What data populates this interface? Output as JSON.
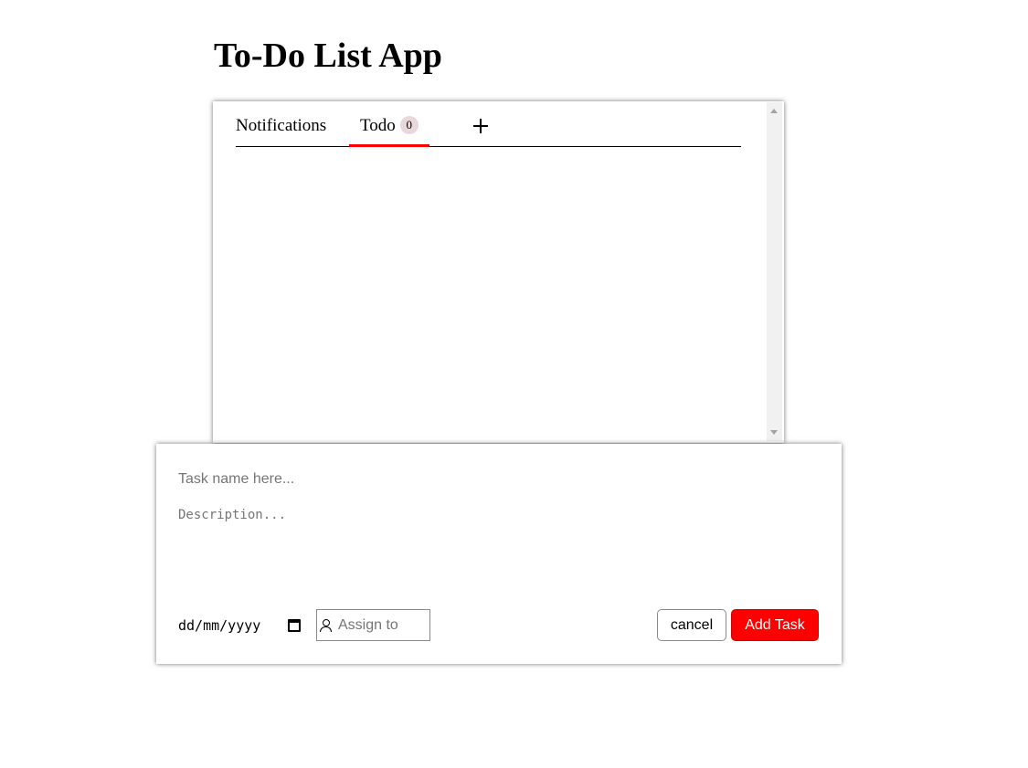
{
  "app": {
    "title": "To-Do List App"
  },
  "tabs": [
    {
      "label": "Notifications",
      "active": false
    },
    {
      "label": "Todo",
      "count": "0",
      "active": true
    }
  ],
  "add_tab": {
    "icon": "plus-icon"
  },
  "task_form": {
    "task_name": {
      "value": "",
      "placeholder": "Task name here..."
    },
    "description": {
      "value": "",
      "placeholder": "Description..."
    },
    "due_date": {
      "display": "dd/mm/yyyy",
      "icon": "calendar-icon"
    },
    "assign_to": {
      "value": "",
      "placeholder": "Assign to",
      "icon": "person-icon"
    },
    "cancel_label": "cancel",
    "submit_label": "Add Task"
  },
  "colors": {
    "accent": "#ff0000",
    "badge_bg": "#e8d7db",
    "scrollbar_track": "#f1f1f1"
  }
}
